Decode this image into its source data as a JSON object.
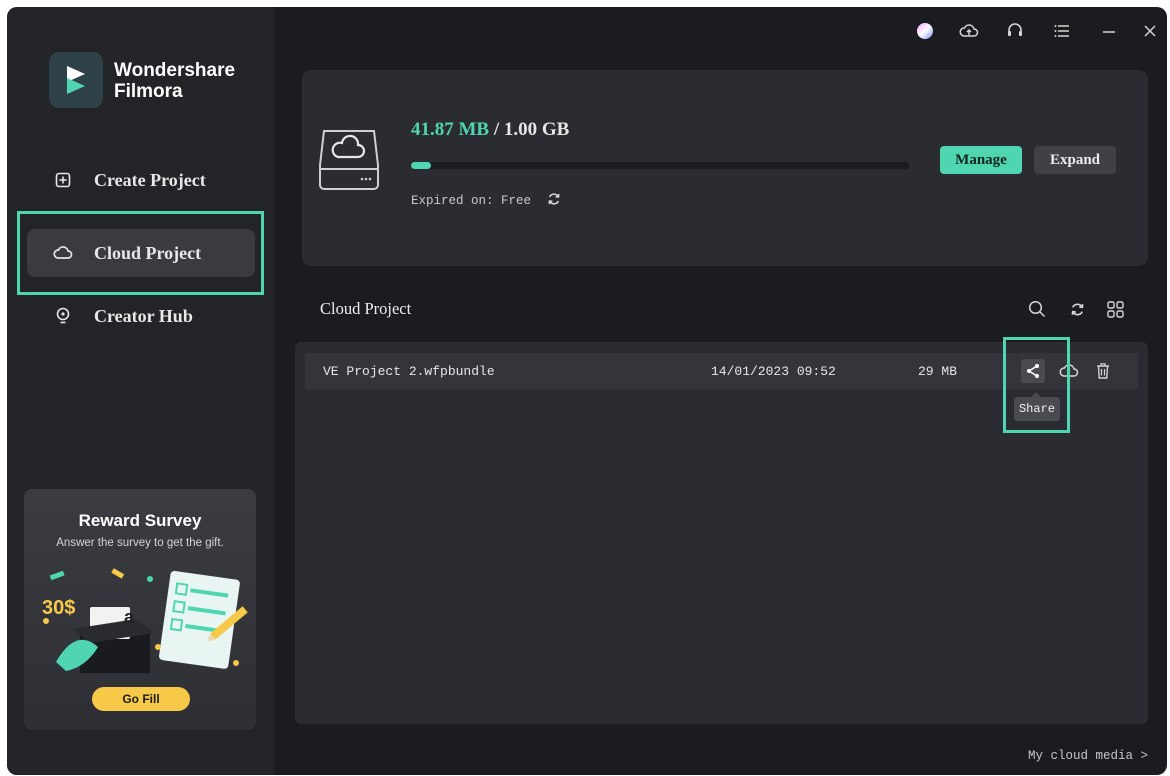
{
  "app": {
    "name_line1": "Wondershare",
    "name_line2": "Filmora"
  },
  "sidebar": {
    "items": [
      {
        "label": "Create Project",
        "icon": "plus-square-icon"
      },
      {
        "label": "Cloud Project",
        "icon": "cloud-icon",
        "active": true
      },
      {
        "label": "Creator Hub",
        "icon": "bulb-icon"
      }
    ],
    "survey": {
      "title": "Reward Survey",
      "subtitle": "Answer the survey to get the gift.",
      "amount": "30$",
      "box_letter": "a",
      "button": "Go Fill"
    }
  },
  "topbar": {
    "icons": [
      "avatar",
      "cloud-upload-icon",
      "headset-icon",
      "menu-icon",
      "minimize-icon",
      "close-icon"
    ]
  },
  "storage": {
    "used": "41.87 MB",
    "separator": " / ",
    "total": "1.00 GB",
    "usage_fraction": 0.04,
    "expired": "Expired on: Free",
    "manage_label": "Manage",
    "expand_label": "Expand"
  },
  "cloud_project": {
    "title": "Cloud Project",
    "files": [
      {
        "name": "VE Project 2.wfpbundle",
        "date": "14/01/2023 09:52",
        "size": "29 MB"
      }
    ],
    "tooltip": "Share"
  },
  "footer": {
    "link": "My cloud media >"
  },
  "colors": {
    "accent": "#4fd6b1",
    "background": "#1b1c20",
    "panel": "#2b2c31",
    "sidebar": "#232428",
    "survey_button": "#f7c948"
  }
}
